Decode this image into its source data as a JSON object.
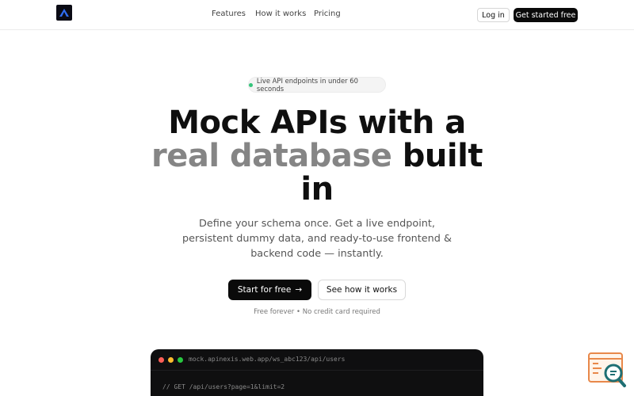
{
  "nav": {
    "features": "Features",
    "how_it_works": "How it works",
    "pricing": "Pricing",
    "login": "Log in",
    "get_started": "Get started free"
  },
  "hero": {
    "badge": "Live API endpoints in under 60 seconds",
    "headline_part1": "Mock APIs with a",
    "headline_muted": "real database",
    "headline_part2": "built in",
    "subtitle": "Define your schema once. Get a live endpoint, persistent dummy data, and ready-to-use frontend & backend code — instantly.",
    "cta_primary": "Start for free",
    "cta_primary_arrow": "→",
    "cta_secondary": "See how it works",
    "fineprint": "Free forever • No credit card required"
  },
  "code_window": {
    "url": "mock.apinexis.web.app/ws_abc123/api/users",
    "line1": "// GET /api/users?page=1&limit=2"
  },
  "icons": {
    "logo": "logo-icon",
    "widget": "search-document-icon",
    "badge_dot": "status-dot-icon",
    "arrow": "arrow-right-icon"
  },
  "colors": {
    "accent": "#0a0a0a",
    "muted_headline": "#858585",
    "status_green": "#34c47a",
    "widget_orange": "#e8884a",
    "widget_teal": "#1f6f73"
  }
}
